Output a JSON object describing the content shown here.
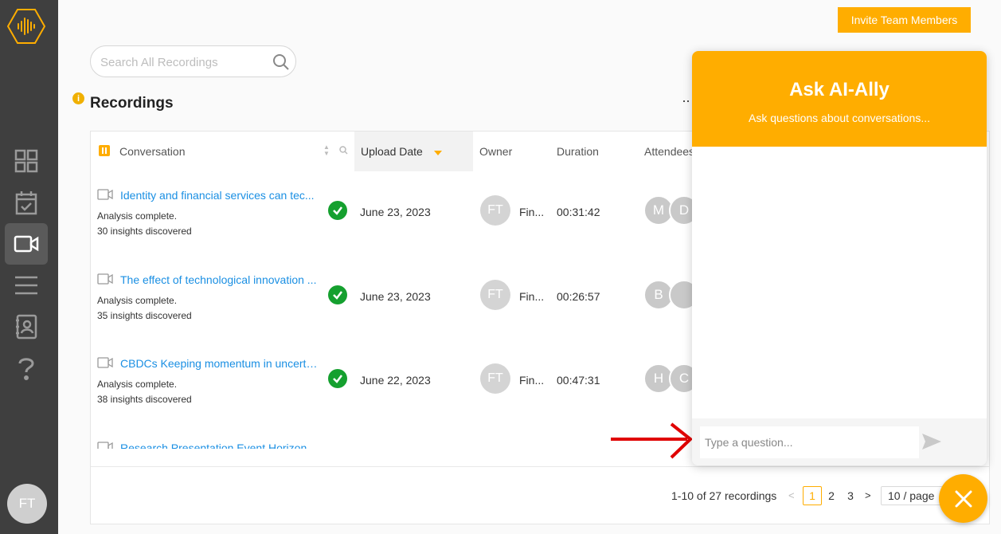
{
  "header": {
    "invite_label": "Invite Team Members",
    "search_placeholder": "Search All Recordings"
  },
  "sidebar": {
    "items": [
      {
        "icon": "dashboard-icon"
      },
      {
        "icon": "calendar-check-icon"
      },
      {
        "icon": "video-camera-icon",
        "active": true
      },
      {
        "icon": "menu-lines-icon"
      },
      {
        "icon": "contacts-icon"
      },
      {
        "icon": "help-icon"
      }
    ],
    "user_initials": "FT"
  },
  "page": {
    "title": "Recordings",
    "info_glyph": "i",
    "more_glyph": "··"
  },
  "table": {
    "columns": {
      "conversation": "Conversation",
      "upload_date": "Upload Date",
      "owner": "Owner",
      "duration": "Duration",
      "attendees": "Attendees"
    },
    "rows": [
      {
        "title": "Identity and financial services can tec...",
        "status": "Analysis complete.",
        "insights": "30 insights discovered",
        "date": "June 23, 2023",
        "owner_initials": "FT",
        "owner_name": "Fin...",
        "duration": "00:31:42",
        "attendees": [
          "M",
          "D"
        ]
      },
      {
        "title": "The effect of technological innovation ...",
        "status": "Analysis complete.",
        "insights": "35 insights discovered",
        "date": "June 23, 2023",
        "owner_initials": "FT",
        "owner_name": "Fin...",
        "duration": "00:26:57",
        "attendees": [
          "B",
          ""
        ]
      },
      {
        "title": "CBDCs Keeping momentum in uncerta...",
        "status": "Analysis complete.",
        "insights": "38 insights discovered",
        "date": "June 22, 2023",
        "owner_initials": "FT",
        "owner_name": "Fin...",
        "duration": "00:47:31",
        "attendees": [
          "H",
          "C"
        ]
      },
      {
        "title": "Research Presentation Event Horizon",
        "status": "",
        "insights": "",
        "date": "",
        "owner_initials": "",
        "owner_name": "",
        "duration": "",
        "attendees": []
      }
    ]
  },
  "pagination": {
    "total": "1-10 of 27 recordings",
    "pages": [
      "1",
      "2",
      "3"
    ],
    "current": "1",
    "prev_glyph": "<",
    "next_glyph": ">",
    "page_size": "10 / page"
  },
  "ai_panel": {
    "title": "Ask AI-Ally",
    "subtitle": "Ask questions about conversations...",
    "input_placeholder": "Type a question..."
  },
  "colors": {
    "accent": "#ffad00",
    "sidebar": "#3f3f3f",
    "link": "#1a8fe3",
    "success": "#15a02f",
    "arrow": "#e00000"
  }
}
